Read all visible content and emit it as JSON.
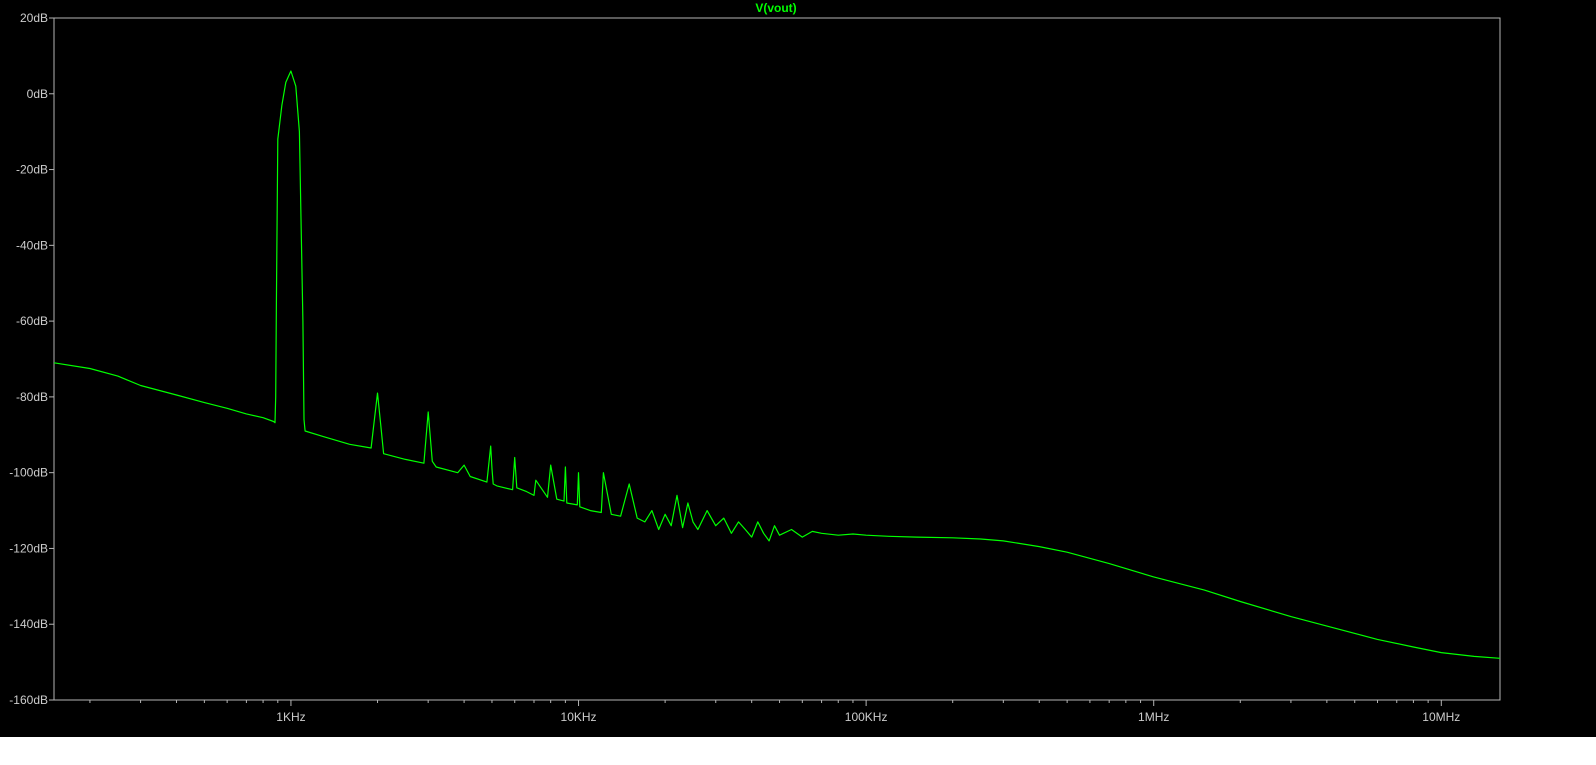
{
  "chart_data": {
    "type": "line",
    "title": "V(vout)",
    "xlabel": "",
    "ylabel": "",
    "x_scale": "log",
    "xlim": [
      150,
      16000000
    ],
    "ylim": [
      -160,
      20
    ],
    "grid": false,
    "legend": "none",
    "x_ticks": [
      {
        "value": 1000,
        "label": "1KHz"
      },
      {
        "value": 10000,
        "label": "10KHz"
      },
      {
        "value": 100000,
        "label": "100KHz"
      },
      {
        "value": 1000000,
        "label": "1MHz"
      },
      {
        "value": 10000000,
        "label": "10MHz"
      }
    ],
    "y_ticks": [
      {
        "value": 20,
        "label": "20dB"
      },
      {
        "value": 0,
        "label": "0dB"
      },
      {
        "value": -20,
        "label": "-20dB"
      },
      {
        "value": -40,
        "label": "-40dB"
      },
      {
        "value": -60,
        "label": "-60dB"
      },
      {
        "value": -80,
        "label": "-80dB"
      },
      {
        "value": -100,
        "label": "-100dB"
      },
      {
        "value": -120,
        "label": "-120dB"
      },
      {
        "value": -140,
        "label": "-140dB"
      },
      {
        "value": -160,
        "label": "-160dB"
      }
    ],
    "series": [
      {
        "color": "#00ff00",
        "x": [
          150,
          200,
          250,
          300,
          400,
          500,
          600,
          700,
          800,
          870,
          880,
          885,
          890,
          900,
          930,
          960,
          1000,
          1040,
          1070,
          1100,
          1110,
          1120,
          1300,
          1600,
          1900,
          1950,
          2000,
          2050,
          2100,
          2500,
          2900,
          3000,
          3100,
          3200,
          3800,
          4000,
          4200,
          4800,
          4950,
          5000,
          5050,
          5200,
          5900,
          6000,
          6100,
          6600,
          7000,
          7100,
          7800,
          8000,
          8400,
          8900,
          9000,
          9100,
          9900,
          10000,
          10100,
          11000,
          12000,
          12200,
          13000,
          14000,
          15000,
          16000,
          17000,
          18000,
          19000,
          20000,
          21000,
          22000,
          23000,
          24000,
          25000,
          26000,
          28000,
          30000,
          32000,
          34000,
          36000,
          38000,
          40000,
          42000,
          44000,
          46000,
          48000,
          50000,
          55000,
          60000,
          65000,
          70000,
          80000,
          90000,
          100000,
          120000,
          150000,
          200000,
          250000,
          300000,
          400000,
          500000,
          700000,
          1000000,
          1500000,
          2000000,
          3000000,
          4000000,
          6000000,
          8000000,
          10000000,
          13000000,
          16000000
        ],
        "y": [
          -71,
          -72.5,
          -74.5,
          -77,
          -79.5,
          -81.5,
          -83,
          -84.5,
          -85.5,
          -86.5,
          -86.8,
          -80,
          -55,
          -12,
          -3,
          3,
          6,
          2,
          -10,
          -60,
          -86,
          -89,
          -90.5,
          -92.5,
          -93.5,
          -86,
          -79,
          -87,
          -95,
          -96.5,
          -97.5,
          -84,
          -97,
          -98.5,
          -100,
          -98,
          -101,
          -102.5,
          -93,
          -99,
          -103,
          -103.5,
          -104.5,
          -96,
          -104,
          -105,
          -106,
          -102,
          -106.5,
          -98,
          -107,
          -107.5,
          -98.5,
          -108,
          -108.5,
          -100,
          -109,
          -110,
          -110.5,
          -100,
          -111,
          -111.5,
          -103,
          -112,
          -113,
          -110,
          -115,
          -111,
          -114,
          -106,
          -114.5,
          -108,
          -113,
          -115,
          -110,
          -114,
          -112,
          -116,
          -113,
          -115,
          -117,
          -113,
          -116,
          -118,
          -114,
          -116.5,
          -115,
          -117,
          -115.5,
          -116,
          -116.5,
          -116.2,
          -116.5,
          -116.8,
          -117,
          -117.2,
          -117.5,
          -118,
          -119.5,
          -121,
          -124,
          -127.5,
          -131,
          -134,
          -138,
          -140.5,
          -144,
          -146,
          -147.5,
          -148.5,
          -149
        ]
      }
    ]
  }
}
